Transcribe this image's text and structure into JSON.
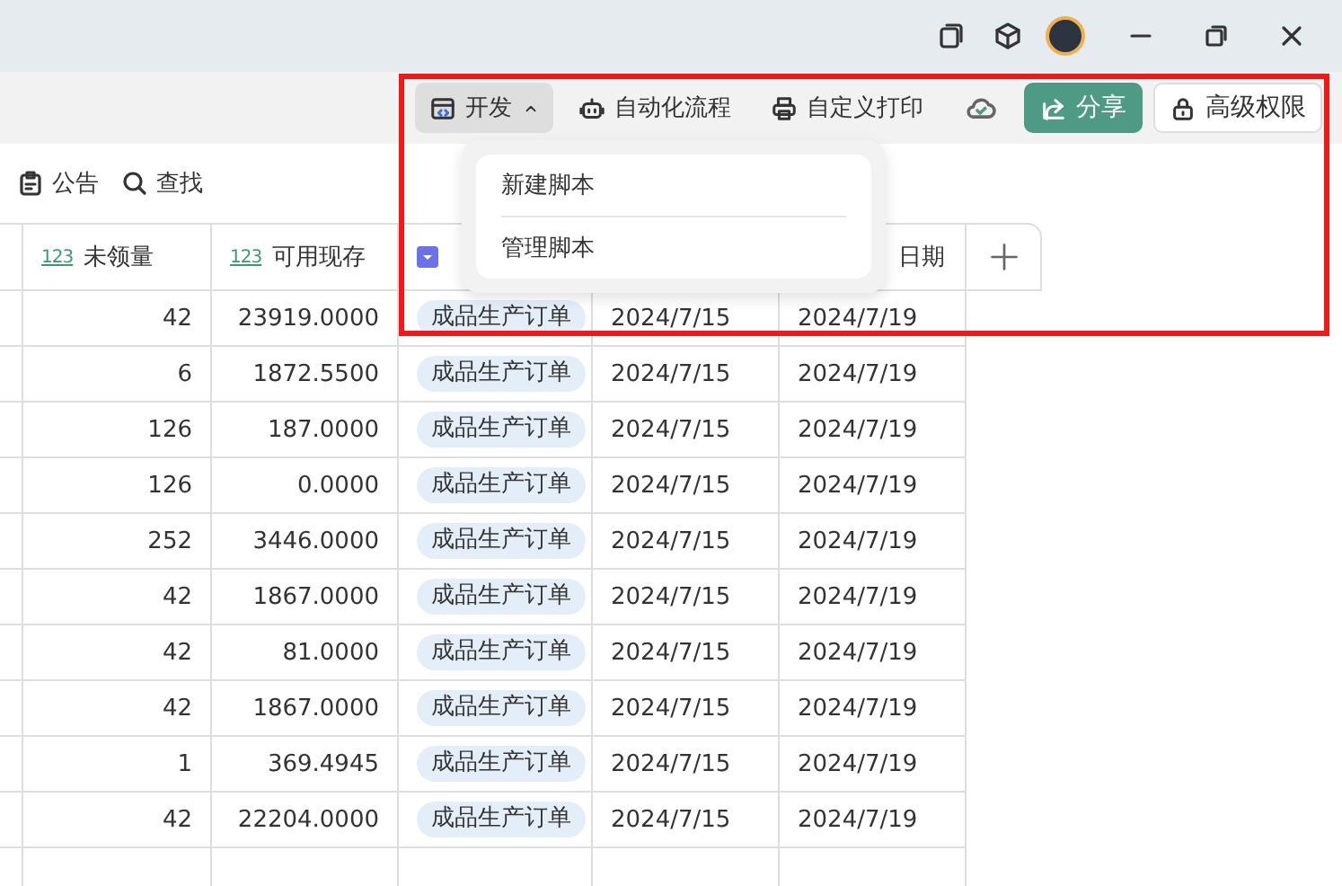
{
  "toolbar": {
    "buttons": [
      {
        "label": "开发",
        "kind": "dropdown",
        "expanded": true
      },
      {
        "label": "自动化流程",
        "kind": "plain"
      },
      {
        "label": "自定义打印",
        "kind": "plain"
      },
      {
        "label": "分享",
        "kind": "primary"
      },
      {
        "label": "高级权限",
        "kind": "outline"
      }
    ]
  },
  "dev_menu": {
    "items": [
      "新建脚本",
      "管理脚本"
    ]
  },
  "view_bar": {
    "actions": [
      "公告",
      "查找"
    ]
  },
  "table": {
    "columns": [
      {
        "label": "未领量",
        "kind": "number",
        "type_badge": "123"
      },
      {
        "label": "可用现存",
        "kind": "number",
        "type_badge": "123"
      },
      {
        "kind": "select"
      },
      {
        "kind": "none"
      },
      {
        "label": "日期",
        "kind": "none"
      }
    ],
    "rows": [
      {
        "cells": [
          "42",
          "23919.0000",
          "成品生产订单",
          "2024/7/15",
          "2024/7/19"
        ]
      },
      {
        "cells": [
          "6",
          "1872.5500",
          "成品生产订单",
          "2024/7/15",
          "2024/7/19"
        ]
      },
      {
        "cells": [
          "126",
          "187.0000",
          "成品生产订单",
          "2024/7/15",
          "2024/7/19"
        ]
      },
      {
        "cells": [
          "126",
          "0.0000",
          "成品生产订单",
          "2024/7/15",
          "2024/7/19"
        ]
      },
      {
        "cells": [
          "252",
          "3446.0000",
          "成品生产订单",
          "2024/7/15",
          "2024/7/19"
        ]
      },
      {
        "cells": [
          "42",
          "1867.0000",
          "成品生产订单",
          "2024/7/15",
          "2024/7/19"
        ]
      },
      {
        "cells": [
          "42",
          "81.0000",
          "成品生产订单",
          "2024/7/15",
          "2024/7/19"
        ]
      },
      {
        "cells": [
          "42",
          "1867.0000",
          "成品生产订单",
          "2024/7/15",
          "2024/7/19"
        ]
      },
      {
        "cells": [
          "1",
          "369.4945",
          "成品生产订单",
          "2024/7/15",
          "2024/7/19"
        ]
      },
      {
        "cells": [
          "42",
          "22204.0000",
          "成品生产订单",
          "2024/7/15",
          "2024/7/19"
        ]
      }
    ]
  }
}
